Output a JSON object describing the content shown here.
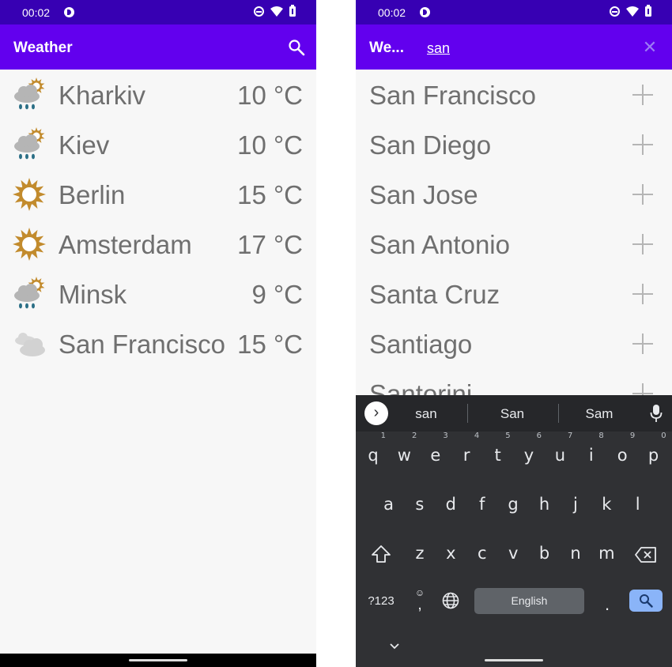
{
  "status_bar": {
    "time": "00:02"
  },
  "left_screen": {
    "title": "Weather",
    "cities": [
      {
        "name": "Kharkiv",
        "temp": "10 °C",
        "icon": "rain-sun-icon"
      },
      {
        "name": "Kiev",
        "temp": "10 °C",
        "icon": "rain-sun-icon"
      },
      {
        "name": "Berlin",
        "temp": "15 °C",
        "icon": "sun-icon"
      },
      {
        "name": "Amsterdam",
        "temp": "17 °C",
        "icon": "sun-icon"
      },
      {
        "name": "Minsk",
        "temp": "9 °C",
        "icon": "rain-sun-icon"
      },
      {
        "name": "San Francisco",
        "temp": "15 °C",
        "icon": "cloud-icon"
      }
    ]
  },
  "right_screen": {
    "title": "We...",
    "search_query": "san",
    "suggestions": [
      "San Francisco",
      "San Diego",
      "San Jose",
      "San Antonio",
      "Santa Cruz",
      "Santiago",
      "Santorini"
    ]
  },
  "keyboard": {
    "suggestions": [
      "san",
      "San",
      "Sam"
    ],
    "row1": [
      "q",
      "w",
      "e",
      "r",
      "t",
      "y",
      "u",
      "i",
      "o",
      "p"
    ],
    "row1_hints": [
      "1",
      "2",
      "3",
      "4",
      "5",
      "6",
      "7",
      "8",
      "9",
      "0"
    ],
    "row2": [
      "a",
      "s",
      "d",
      "f",
      "g",
      "h",
      "j",
      "k",
      "l"
    ],
    "row3": [
      "z",
      "x",
      "c",
      "v",
      "b",
      "n",
      "m"
    ],
    "symbols_label": "?123",
    "comma": ",",
    "space_label": "English",
    "period": "."
  },
  "colors": {
    "status_bar": "#3700b3",
    "app_bar": "#6200ee",
    "keyboard_bg": "#303134",
    "search_key": "#8ab4f8",
    "sun": "#c28b2d",
    "rain": "#2b6f86"
  }
}
